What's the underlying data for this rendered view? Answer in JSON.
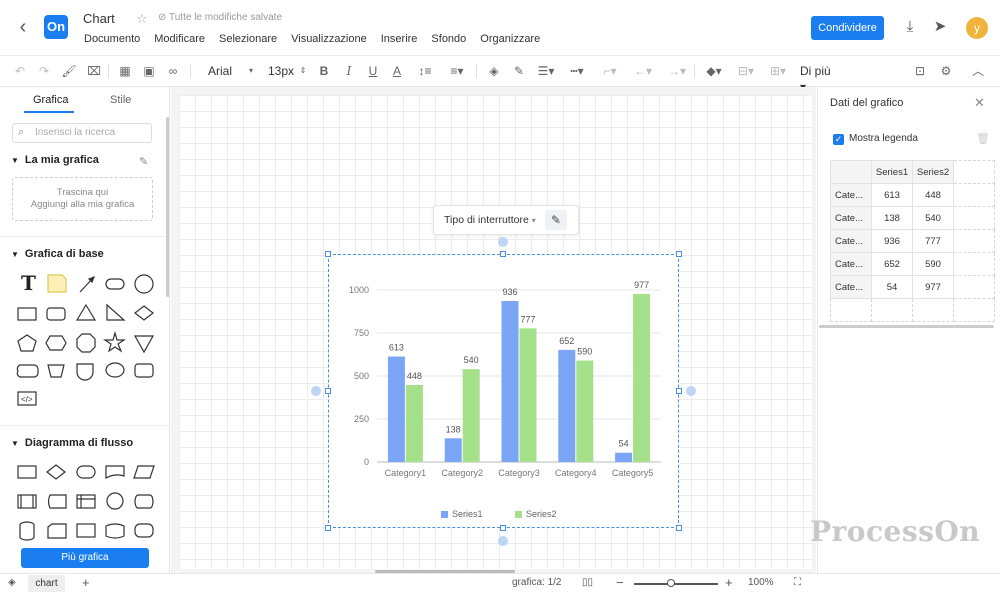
{
  "header": {
    "title": "Chart",
    "saved_status": "Tutte le modifiche salvate",
    "logo_text": "On",
    "menu": [
      "Documento",
      "Modificare",
      "Selezionare",
      "Visualizzazione",
      "Inserire",
      "Sfondo",
      "Organizzare"
    ],
    "share_label": "Condividere",
    "avatar_letter": "y"
  },
  "toolbar": {
    "font": "Arial",
    "font_size": "13px",
    "more_label": "Di più"
  },
  "left_panel": {
    "tabs": [
      "Grafica",
      "Stile"
    ],
    "search_placeholder": "Inserisci la ricerca",
    "my_graphics": "La mia grafica",
    "drop_line1": "Trascina qui",
    "drop_line2": "Aggiungi alla mia grafica",
    "basic_graphics": "Grafica di base",
    "flowchart": "Diagramma di flusso",
    "more_button": "Più grafica"
  },
  "float_toolbar": {
    "switch_type": "Tipo di interruttore"
  },
  "right_panel": {
    "title": "Dati del grafico",
    "show_legend": "Mostra legenda",
    "columns": [
      "Series1",
      "Series2"
    ],
    "rows": [
      {
        "label": "Cate...",
        "values": [
          "613",
          "448"
        ]
      },
      {
        "label": "Cate...",
        "values": [
          "138",
          "540"
        ]
      },
      {
        "label": "Cate...",
        "values": [
          "936",
          "777"
        ]
      },
      {
        "label": "Cate...",
        "values": [
          "652",
          "590"
        ]
      },
      {
        "label": "Cate...",
        "values": [
          "54",
          "977"
        ]
      }
    ]
  },
  "status": {
    "page_tab": "chart",
    "page_info": "grafica:  1/2",
    "zoom": "100%"
  },
  "watermark": "ProcessOn",
  "colors": {
    "accent": "#1a7ef0",
    "series1": "#7aa6f5",
    "series2": "#a5e08a"
  },
  "chart_data": {
    "type": "bar",
    "categories": [
      "Category1",
      "Category2",
      "Category3",
      "Category4",
      "Category5"
    ],
    "series": [
      {
        "name": "Series1",
        "values": [
          613,
          138,
          936,
          652,
          54
        ]
      },
      {
        "name": "Series2",
        "values": [
          448,
          540,
          777,
          590,
          977
        ]
      }
    ],
    "yticks": [
      0,
      250,
      500,
      750,
      1000
    ],
    "ylim": [
      0,
      1000
    ],
    "legend": "bottom",
    "grid": true
  }
}
